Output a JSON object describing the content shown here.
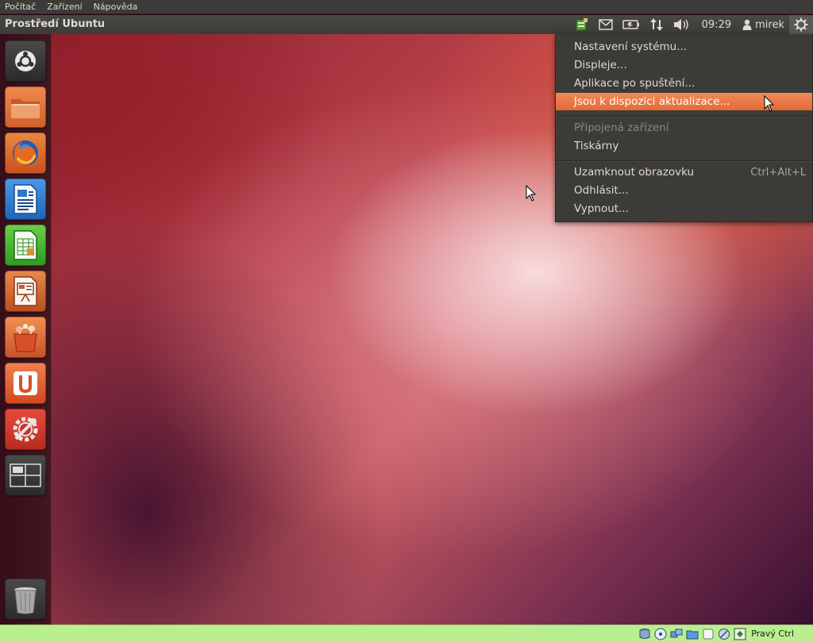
{
  "host_menubar": {
    "items": [
      "Počítač",
      "Zařízení",
      "Nápověda"
    ]
  },
  "top_panel": {
    "title": "Prostředí Ubuntu",
    "clock": "09:29",
    "user": "mirek"
  },
  "session_menu": {
    "items": [
      {
        "label": "Nastavení systému...",
        "state": "normal"
      },
      {
        "label": "Displeje...",
        "state": "normal"
      },
      {
        "label": "Aplikace po spuštění...",
        "state": "normal"
      },
      {
        "label": "Jsou k dispozici aktualizace...",
        "state": "highlighted"
      },
      {
        "label": "Připojená zařízení",
        "state": "disabled"
      },
      {
        "label": "Tiskárny",
        "state": "normal"
      },
      {
        "label": "Uzamknout obrazovku",
        "state": "normal",
        "accelerator": "Ctrl+Alt+L"
      },
      {
        "label": "Odhlásit...",
        "state": "normal"
      },
      {
        "label": "Vypnout...",
        "state": "normal"
      }
    ]
  },
  "launcher": {
    "items": [
      {
        "name": "dash-home-icon",
        "color": "#3a3a3a"
      },
      {
        "name": "home-folder-icon",
        "color": "#e0703a"
      },
      {
        "name": "firefox-icon",
        "color": "#d4601e"
      },
      {
        "name": "libreoffice-writer-icon",
        "color": "#2a78c8"
      },
      {
        "name": "libreoffice-calc-icon",
        "color": "#3ca82e"
      },
      {
        "name": "libreoffice-impress-icon",
        "color": "#c85e2a"
      },
      {
        "name": "software-center-icon",
        "color": "#d8502a"
      },
      {
        "name": "ubuntu-one-icon",
        "color": "#d8502a"
      },
      {
        "name": "system-settings-icon",
        "color": "#c8302a"
      },
      {
        "name": "workspace-switcher-icon",
        "color": "#3a3a3a"
      },
      {
        "name": "trash-icon",
        "color": "#3a3a3a"
      }
    ]
  },
  "host_statusbar": {
    "host_key": "Pravý Ctrl"
  }
}
